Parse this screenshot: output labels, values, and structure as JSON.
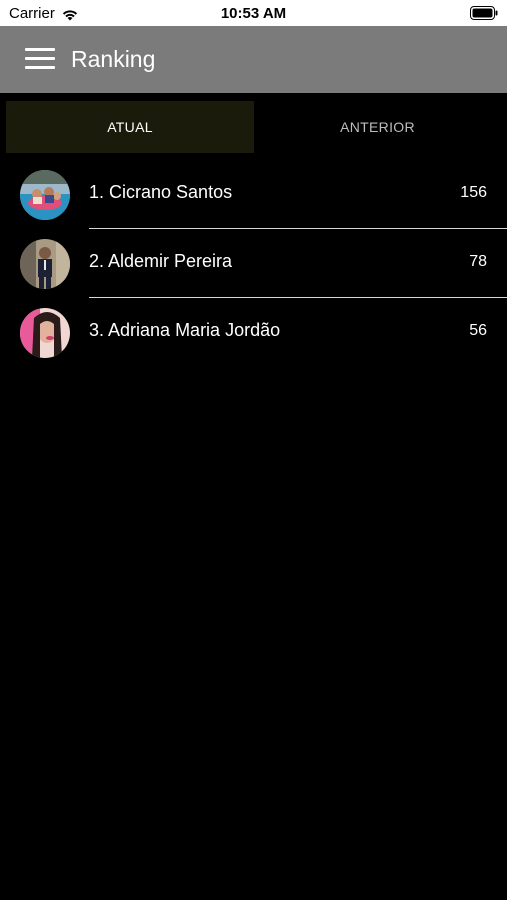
{
  "status_bar": {
    "carrier": "Carrier",
    "time": "10:53 AM",
    "wifi_icon": "wifi-icon",
    "battery_icon": "battery-icon"
  },
  "app_bar": {
    "menu_icon": "menu-icon",
    "title": "Ranking"
  },
  "tabs": [
    {
      "label": "ATUAL",
      "selected": true
    },
    {
      "label": "ANTERIOR",
      "selected": false
    }
  ],
  "ranking": [
    {
      "name": "1. Cicrano Santos",
      "score": "156"
    },
    {
      "name": "2. Aldemir Pereira",
      "score": "78"
    },
    {
      "name": "3. Adriana Maria Jordão",
      "score": "56"
    }
  ],
  "colors": {
    "app_bar": "#7b7b7b",
    "background": "#000000",
    "selected_tab": "#1b1b0b",
    "divider": "#d8d8d8"
  }
}
